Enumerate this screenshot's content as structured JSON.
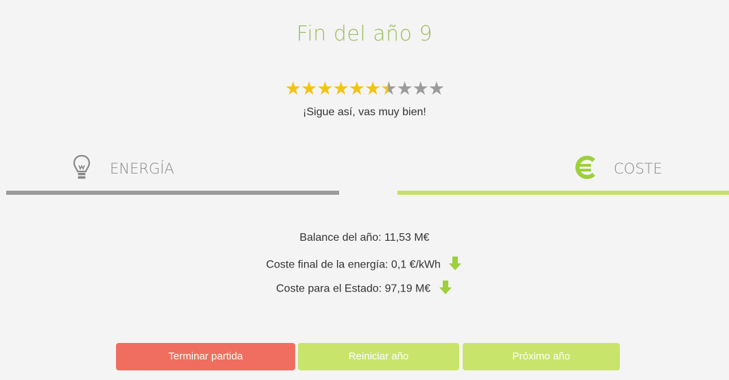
{
  "title": "Fin del año 9",
  "rating": {
    "value": 6.5,
    "max": 10
  },
  "message": "¡Sigue así, vas muy bien!",
  "tabs": {
    "energy": {
      "label": "ENERGÍA",
      "icon": "lightbulb-icon"
    },
    "cost": {
      "label": "COSTE",
      "icon": "euro-icon",
      "active": true
    }
  },
  "stats": {
    "balance": "Balance del año: 11,53 M€",
    "energy_cost": "Coste final de la energía: 0,1 €/kWh",
    "state_cost": "Coste para el Estado: 97,19 M€"
  },
  "buttons": {
    "end": "Terminar partida",
    "restart": "Reiniciar año",
    "next": "Próximo año"
  },
  "colors": {
    "accent": "#c6e06a",
    "title": "#9bbd5c",
    "danger": "#f06e60",
    "star": "#f3c316",
    "star_empty": "#9b9b9b"
  }
}
